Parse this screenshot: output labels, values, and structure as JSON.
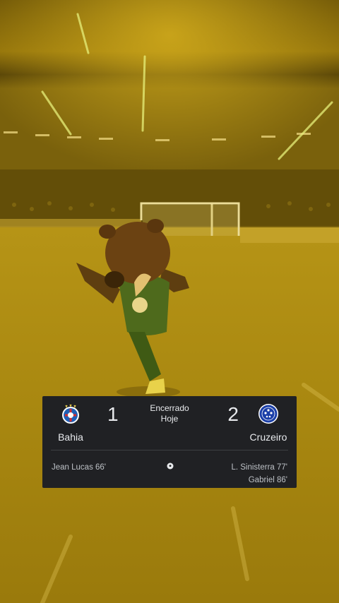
{
  "match": {
    "status": "Encerrado",
    "day": "Hoje",
    "home": {
      "name": "Bahia",
      "score": "1",
      "scorers": [
        "Jean Lucas 66'"
      ],
      "color": "#1f5fb5"
    },
    "away": {
      "name": "Cruzeiro",
      "score": "2",
      "scorers": [
        "L. Sinisterra 77'",
        "Gabriel 86'"
      ],
      "color": "#1b3fa8"
    },
    "goal_icon": "soccer-ball-icon"
  },
  "scene": {
    "description_icon": "mascot-bear",
    "tint": "#c9a31a"
  }
}
